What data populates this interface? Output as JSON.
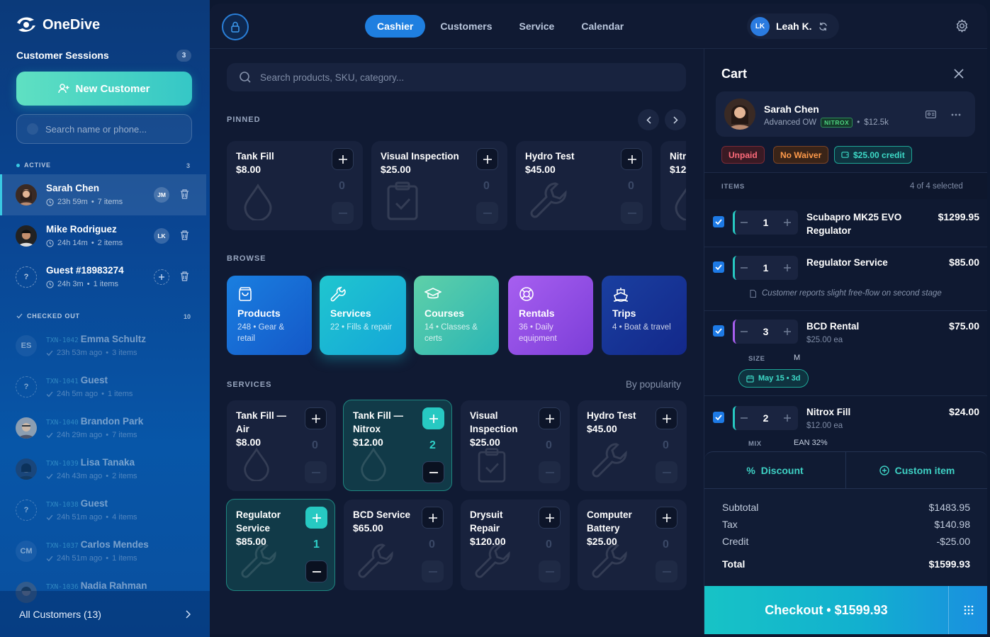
{
  "brand": {
    "name": "OneDive"
  },
  "sidebar": {
    "sessions_title": "Customer Sessions",
    "sessions_count": "3",
    "new_customer": "New Customer",
    "search_placeholder": "Search name or phone...",
    "active_label": "ACTIVE",
    "active_count": "3",
    "active": [
      {
        "name": "Sarah Chen",
        "time": "23h 59m",
        "items": "7 items",
        "badge": "JM"
      },
      {
        "name": "Mike Rodriguez",
        "time": "24h 14m",
        "items": "2 items",
        "badge": "LK"
      },
      {
        "name": "Guest #18983274",
        "time": "24h 3m",
        "items": "1 items",
        "avatar": "?"
      }
    ],
    "checked_label": "CHECKED OUT",
    "checked_count": "10",
    "checked": [
      {
        "txn": "TXN-1042",
        "name": "Emma Schultz",
        "time": "23h 53m ago",
        "items": "3 items",
        "initials": "ES"
      },
      {
        "txn": "TXN-1041",
        "name": "Guest",
        "time": "24h 5m ago",
        "items": "1 items",
        "initials": "?"
      },
      {
        "txn": "TXN-1040",
        "name": "Brandon Park",
        "time": "24h 29m ago",
        "items": "7 items"
      },
      {
        "txn": "TXN-1039",
        "name": "Lisa Tanaka",
        "time": "24h 43m ago",
        "items": "2 items"
      },
      {
        "txn": "TXN-1038",
        "name": "Guest",
        "time": "24h 51m ago",
        "items": "4 items",
        "initials": "?"
      },
      {
        "txn": "TXN-1037",
        "name": "Carlos Mendes",
        "time": "24h 51m ago",
        "items": "1 items",
        "initials": "CM"
      },
      {
        "txn": "TXN-1036",
        "name": "Nadia Rahman"
      }
    ],
    "all_customers": "All Customers (13)"
  },
  "nav": {
    "tabs": [
      "Cashier",
      "Customers",
      "Service",
      "Calendar"
    ],
    "active": "Cashier",
    "user_initials": "LK",
    "user_name": "Leah K."
  },
  "catalog": {
    "search_placeholder": "Search products, SKU, category...",
    "pinned_label": "PINNED",
    "pinned": [
      {
        "title": "Tank Fill",
        "price": "$8.00",
        "qty": "0"
      },
      {
        "title": "Visual Inspection",
        "price": "$25.00",
        "qty": "0"
      },
      {
        "title": "Hydro Test",
        "price": "$45.00",
        "qty": "0"
      },
      {
        "title": "Nitr",
        "price": "$12",
        "qty": "0"
      }
    ],
    "browse_label": "BROWSE",
    "browse": [
      {
        "title": "Products",
        "sub": "248 • Gear & retail"
      },
      {
        "title": "Services",
        "sub": "22 • Fills & repair"
      },
      {
        "title": "Courses",
        "sub": "14 • Classes & certs"
      },
      {
        "title": "Rentals",
        "sub": "36 • Daily equipment"
      },
      {
        "title": "Trips",
        "sub": "4 • Boat & travel"
      }
    ],
    "services_label": "SERVICES",
    "sort_label": "By popularity",
    "services": [
      {
        "title": "Tank Fill — Air",
        "price": "$8.00",
        "qty": "0"
      },
      {
        "title": "Tank Fill — Nitrox",
        "price": "$12.00",
        "qty": "2"
      },
      {
        "title": "Visual Inspection",
        "price": "$25.00",
        "qty": "0"
      },
      {
        "title": "Hydro Test",
        "price": "$45.00",
        "qty": "0"
      },
      {
        "title": "Regulator Service",
        "price": "$85.00",
        "qty": "1"
      },
      {
        "title": "BCD Service",
        "price": "$65.00",
        "qty": "0"
      },
      {
        "title": "Drysuit Repair",
        "price": "$120.00",
        "qty": "0"
      },
      {
        "title": "Computer Battery",
        "price": "$25.00",
        "qty": "0"
      }
    ]
  },
  "cart": {
    "title": "Cart",
    "customer": {
      "name": "Sarah Chen",
      "cert": "Advanced OW",
      "badge": "NITROX",
      "value": "$12.5k"
    },
    "tags": {
      "unpaid": "Unpaid",
      "waiver": "No Waiver",
      "credit": "$25.00 credit"
    },
    "items_label": "ITEMS",
    "selected": "4 of 4 selected",
    "lines": [
      {
        "qty": "1",
        "name": "Scubapro MK25 EVO Regulator",
        "price": "$1299.95"
      },
      {
        "qty": "1",
        "name": "Regulator Service",
        "price": "$85.00",
        "note": "Customer reports slight free-flow on second stage"
      },
      {
        "qty": "3",
        "name": "BCD Rental",
        "price": "$75.00",
        "each": "$25.00 ea",
        "attr_key": "SIZE",
        "attr_val": "M",
        "dates": "May 15 • 3d"
      },
      {
        "qty": "2",
        "name": "Nitrox Fill",
        "price": "$24.00",
        "each": "$12.00 ea",
        "attr_key": "MIX",
        "attr_val": "EAN 32%"
      }
    ],
    "discount": "Discount",
    "custom_item": "Custom item",
    "subtotal_label": "Subtotal",
    "subtotal": "$1483.95",
    "tax_label": "Tax",
    "tax": "$140.98",
    "credit_label": "Credit",
    "credit": "-$25.00",
    "total_label": "Total",
    "total": "$1599.93",
    "checkout": "Checkout • $1599.93"
  },
  "colors": {
    "accent": "#1f7fe0",
    "teal": "#27c9c2"
  }
}
